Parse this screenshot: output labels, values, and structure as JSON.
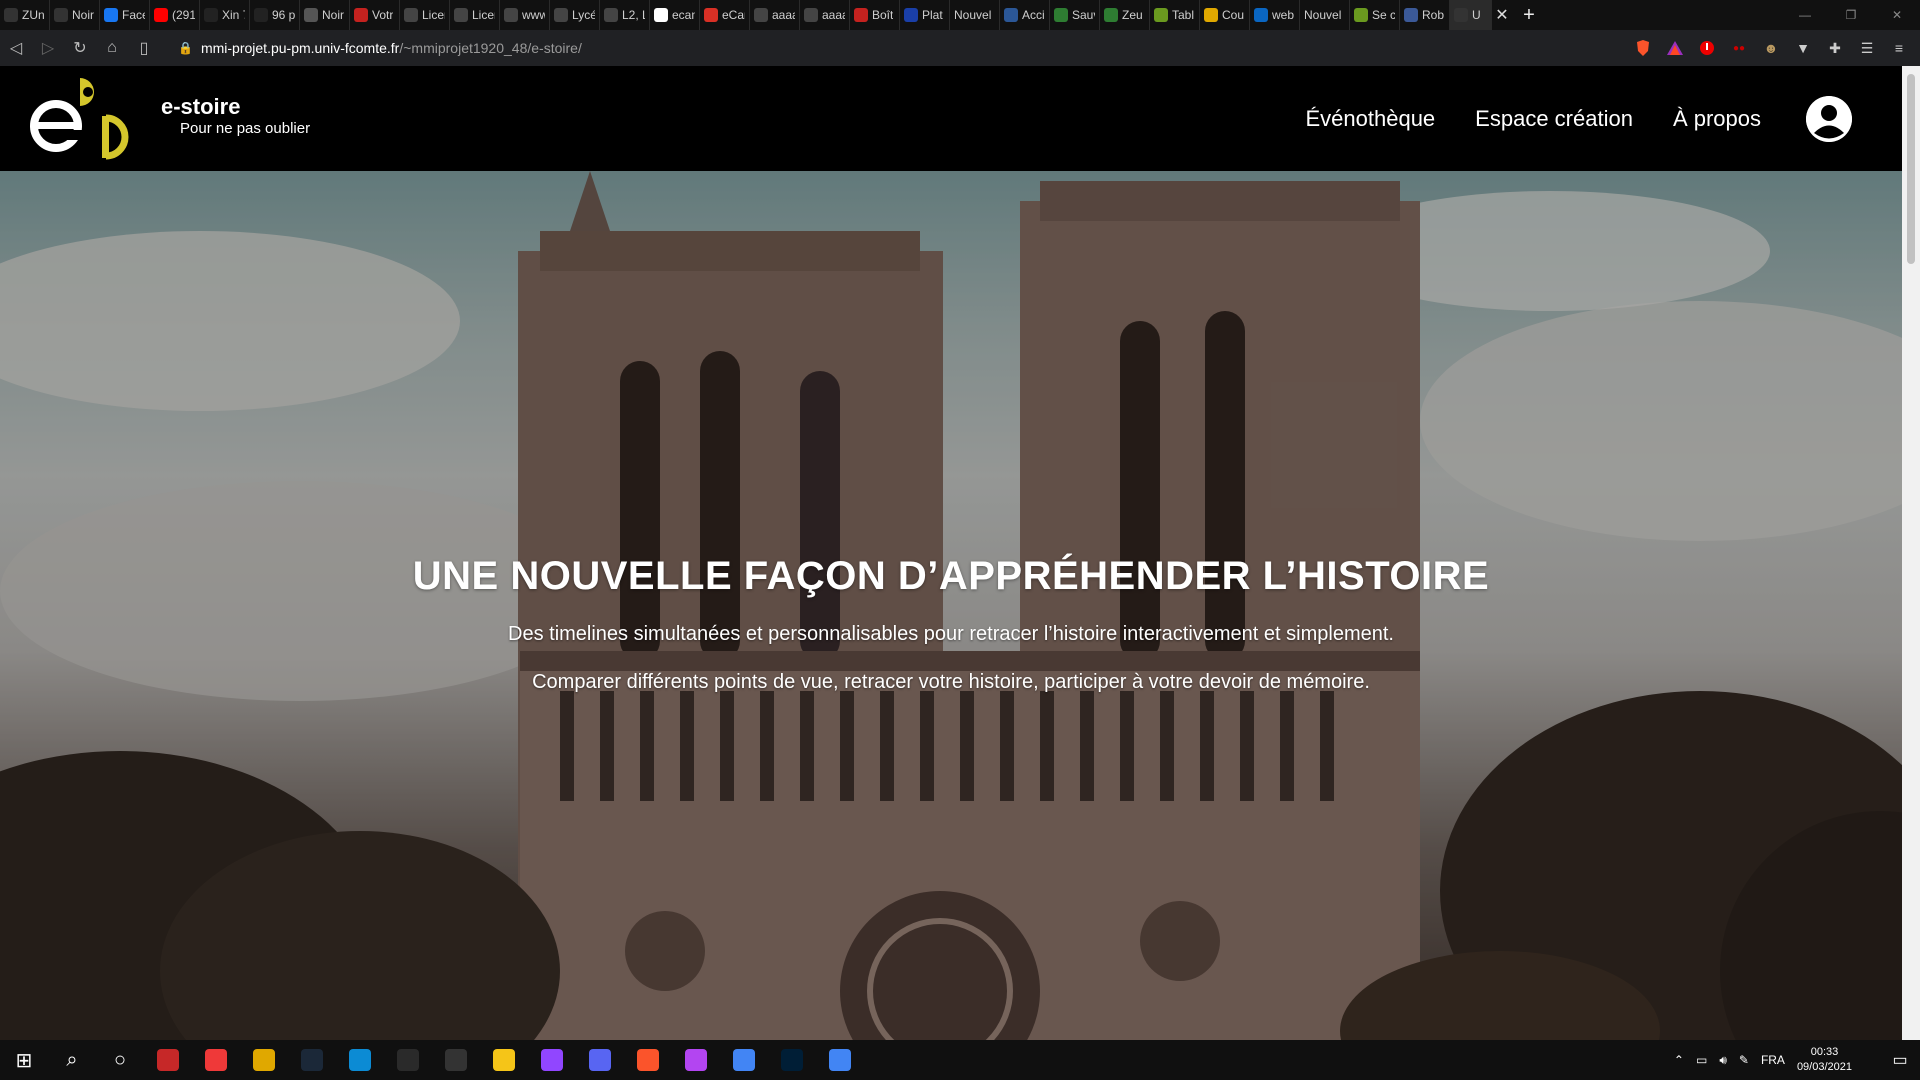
{
  "browser": {
    "tabs": [
      {
        "title": "ZUn",
        "icon": "z-icon",
        "color": "#333"
      },
      {
        "title": "Noir",
        "icon": "z-icon",
        "color": "#333"
      },
      {
        "title": "Face",
        "icon": "facebook-icon",
        "color": "#1877f2"
      },
      {
        "title": "(291",
        "icon": "youtube-icon",
        "color": "#ff0000"
      },
      {
        "title": "Xin 7",
        "icon": "pb-icon",
        "color": "#222"
      },
      {
        "title": "96 p",
        "icon": "pb-icon",
        "color": "#222"
      },
      {
        "title": "Noir",
        "icon": "skull-icon",
        "color": "#555"
      },
      {
        "title": "Votr",
        "icon": "gmail-icon",
        "color": "#c5221f"
      },
      {
        "title": "Licer",
        "icon": "page-icon",
        "color": "#444"
      },
      {
        "title": "Licer",
        "icon": "page-icon",
        "color": "#444"
      },
      {
        "title": "www",
        "icon": "globe-icon",
        "color": "#444"
      },
      {
        "title": "Lycé",
        "icon": "page-icon",
        "color": "#444"
      },
      {
        "title": "L2, L",
        "icon": "page-icon",
        "color": "#444"
      },
      {
        "title": "ecan",
        "icon": "google-icon",
        "color": "#fff"
      },
      {
        "title": "eCar",
        "icon": "ecampus-icon",
        "color": "#d93025"
      },
      {
        "title": "aaaa",
        "icon": "globe-icon",
        "color": "#444"
      },
      {
        "title": "aaaa",
        "icon": "globe-icon",
        "color": "#444"
      },
      {
        "title": "Boît",
        "icon": "gmail-icon",
        "color": "#c5221f"
      },
      {
        "title": "Plat",
        "icon": "flag-icon",
        "color": "#1a3fa8"
      },
      {
        "title": "Nouvel o",
        "icon": "",
        "color": "#111"
      },
      {
        "title": "Acci",
        "icon": "page-icon",
        "color": "#2b5797"
      },
      {
        "title": "Sauv",
        "icon": "shield-icon",
        "color": "#2e7d32"
      },
      {
        "title": "Zeu",
        "icon": "shield-icon",
        "color": "#2e7d32"
      },
      {
        "title": "Tabl",
        "icon": "leaf-icon",
        "color": "#6a9a1f"
      },
      {
        "title": "Cou",
        "icon": "m-icon",
        "color": "#e0a800"
      },
      {
        "title": "web",
        "icon": "k-icon",
        "color": "#0a66c2"
      },
      {
        "title": "Nouvel o",
        "icon": "",
        "color": "#111"
      },
      {
        "title": "Se c",
        "icon": "leaf-icon",
        "color": "#6a9a1f"
      },
      {
        "title": "Rob",
        "icon": "puzzle-icon",
        "color": "#3b5998"
      },
      {
        "title": "U",
        "icon": "estoire-icon",
        "color": "#333"
      }
    ],
    "close_tab": "✕",
    "new_tab": "+",
    "url_host": "mmi-projet.pu-pm.univ-fcomte.fr",
    "url_path": "/~mmiprojet1920_48/e-stoire/"
  },
  "site": {
    "brand_name": "e-stoire",
    "tagline": "Pour ne pas oublier",
    "nav": [
      "Événothèque",
      "Espace création",
      "À propos"
    ],
    "accent_color": "#d4c62c",
    "hero": {
      "title": "UNE NOUVELLE FAÇON D’APPRÉHENDER L’HISTOIRE",
      "line1": "Des timelines simultanées et personnalisables pour retracer l’histoire interactivement et simplement.",
      "line2": "Comparer différents points de vue, retracer votre histoire, participer à votre devoir de mémoire."
    }
  },
  "taskbar": {
    "apps": [
      {
        "name": "start",
        "icon": "windows-icon"
      },
      {
        "name": "search",
        "icon": "search-icon"
      },
      {
        "name": "cortana",
        "icon": "circle-icon"
      },
      {
        "name": "app-red",
        "icon": "app-icon",
        "color": "#c62828"
      },
      {
        "name": "vivaldi",
        "icon": "vivaldi-icon",
        "color": "#ef3939"
      },
      {
        "name": "app-m",
        "icon": "app-icon",
        "color": "#e0a800"
      },
      {
        "name": "steam",
        "icon": "steam-icon",
        "color": "#1b2838"
      },
      {
        "name": "edge",
        "icon": "edge-icon",
        "color": "#0c8bd4"
      },
      {
        "name": "epic",
        "icon": "epic-icon",
        "color": "#2a2a2a"
      },
      {
        "name": "unity",
        "icon": "unity-icon",
        "color": "#333"
      },
      {
        "name": "explorer",
        "icon": "folder-icon",
        "color": "#f5c518"
      },
      {
        "name": "twitch",
        "icon": "twitch-icon",
        "color": "#9146ff"
      },
      {
        "name": "discord",
        "icon": "discord-icon",
        "color": "#5865f2"
      },
      {
        "name": "brave",
        "icon": "brave-icon",
        "color": "#fb542b"
      },
      {
        "name": "phpstorm",
        "icon": "phpstorm-icon",
        "color": "#b345f1"
      },
      {
        "name": "chrome",
        "icon": "chrome-icon",
        "color": "#4285f4"
      },
      {
        "name": "photoshop",
        "icon": "photoshop-icon",
        "color": "#001e36"
      },
      {
        "name": "chrome2",
        "icon": "chrome-icon",
        "color": "#4285f4"
      }
    ],
    "language": "FRA",
    "time": "00:33",
    "date": "09/03/2021"
  }
}
